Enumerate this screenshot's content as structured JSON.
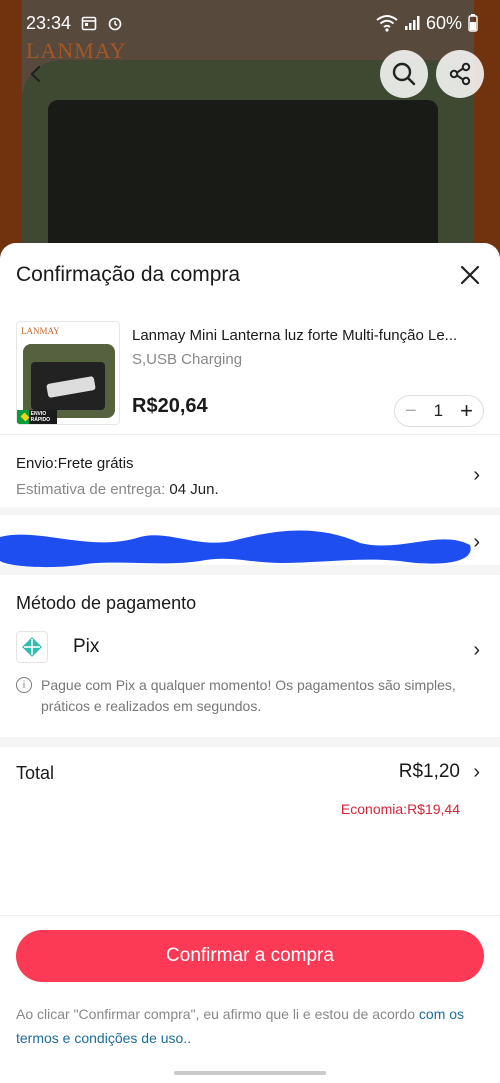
{
  "status_bar": {
    "time": "23:34",
    "battery": "60%"
  },
  "background": {
    "logo": "LANMAY"
  },
  "sheet": {
    "title": "Confirmação da compra"
  },
  "product": {
    "name": "Lanmay Mini Lanterna luz forte Multi-função Le...",
    "variant": "S,USB Charging",
    "price": "R$20,64",
    "quantity": "1",
    "thumb_logo": "LANMAY",
    "badge": "ENVIO RÁPIDO"
  },
  "shipping": {
    "title": "Envio:Frete grátis",
    "eta_label": "Estimativa de entrega:",
    "eta_date": "04 Jun."
  },
  "payment": {
    "title": "Método de pagamento",
    "method": "Pix",
    "note": "Pague com Pix a qualquer momento! Os pagamentos são simples, práticos e realizados em segundos."
  },
  "total": {
    "label": "Total",
    "value": "R$1,20",
    "savings": "Economia:R$19,44"
  },
  "footer": {
    "confirm_label": "Confirmar a compra",
    "terms_text": "Ao clicar \"Confirmar compra\", eu afirmo que li e estou de acordo ",
    "terms_link": "com os termos e condições de uso.."
  },
  "colors": {
    "accent": "#fc3a55",
    "savings": "#d3253a",
    "link": "#1d6d9b",
    "pix": "#32bcad",
    "redaction": "#1f4ef0"
  }
}
